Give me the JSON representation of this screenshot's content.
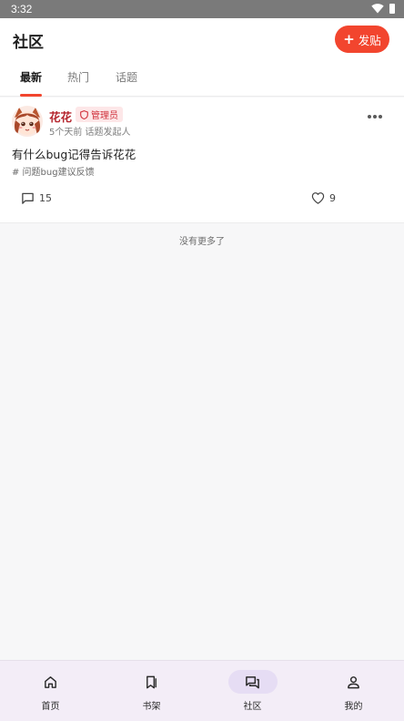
{
  "status_bar": {
    "time": "3:32"
  },
  "header": {
    "title": "社区",
    "post_button_label": "发贴"
  },
  "tabs": [
    {
      "label": "最新",
      "active": true
    },
    {
      "label": "热门",
      "active": false
    },
    {
      "label": "话题",
      "active": false
    }
  ],
  "post": {
    "author": "花花",
    "badge": "管理员",
    "meta": "5个天前 话题发起人",
    "content": "有什么bug记得告诉花花",
    "tag": "# 问题bug建议反馈",
    "comment_count": "15",
    "like_count": "9"
  },
  "end_message": "没有更多了",
  "bottom_nav": [
    {
      "label": "首页",
      "icon": "home-icon",
      "active": false
    },
    {
      "label": "书架",
      "icon": "bookmark-icon",
      "active": false
    },
    {
      "label": "社区",
      "icon": "forum-icon",
      "active": true
    },
    {
      "label": "我的",
      "icon": "person-icon",
      "active": false
    }
  ],
  "colors": {
    "accent": "#f2452e",
    "author": "#b5262e",
    "badge_bg": "#fde7e8",
    "nav_bg": "#f3edf7",
    "nav_active": "#e6ddf4"
  }
}
